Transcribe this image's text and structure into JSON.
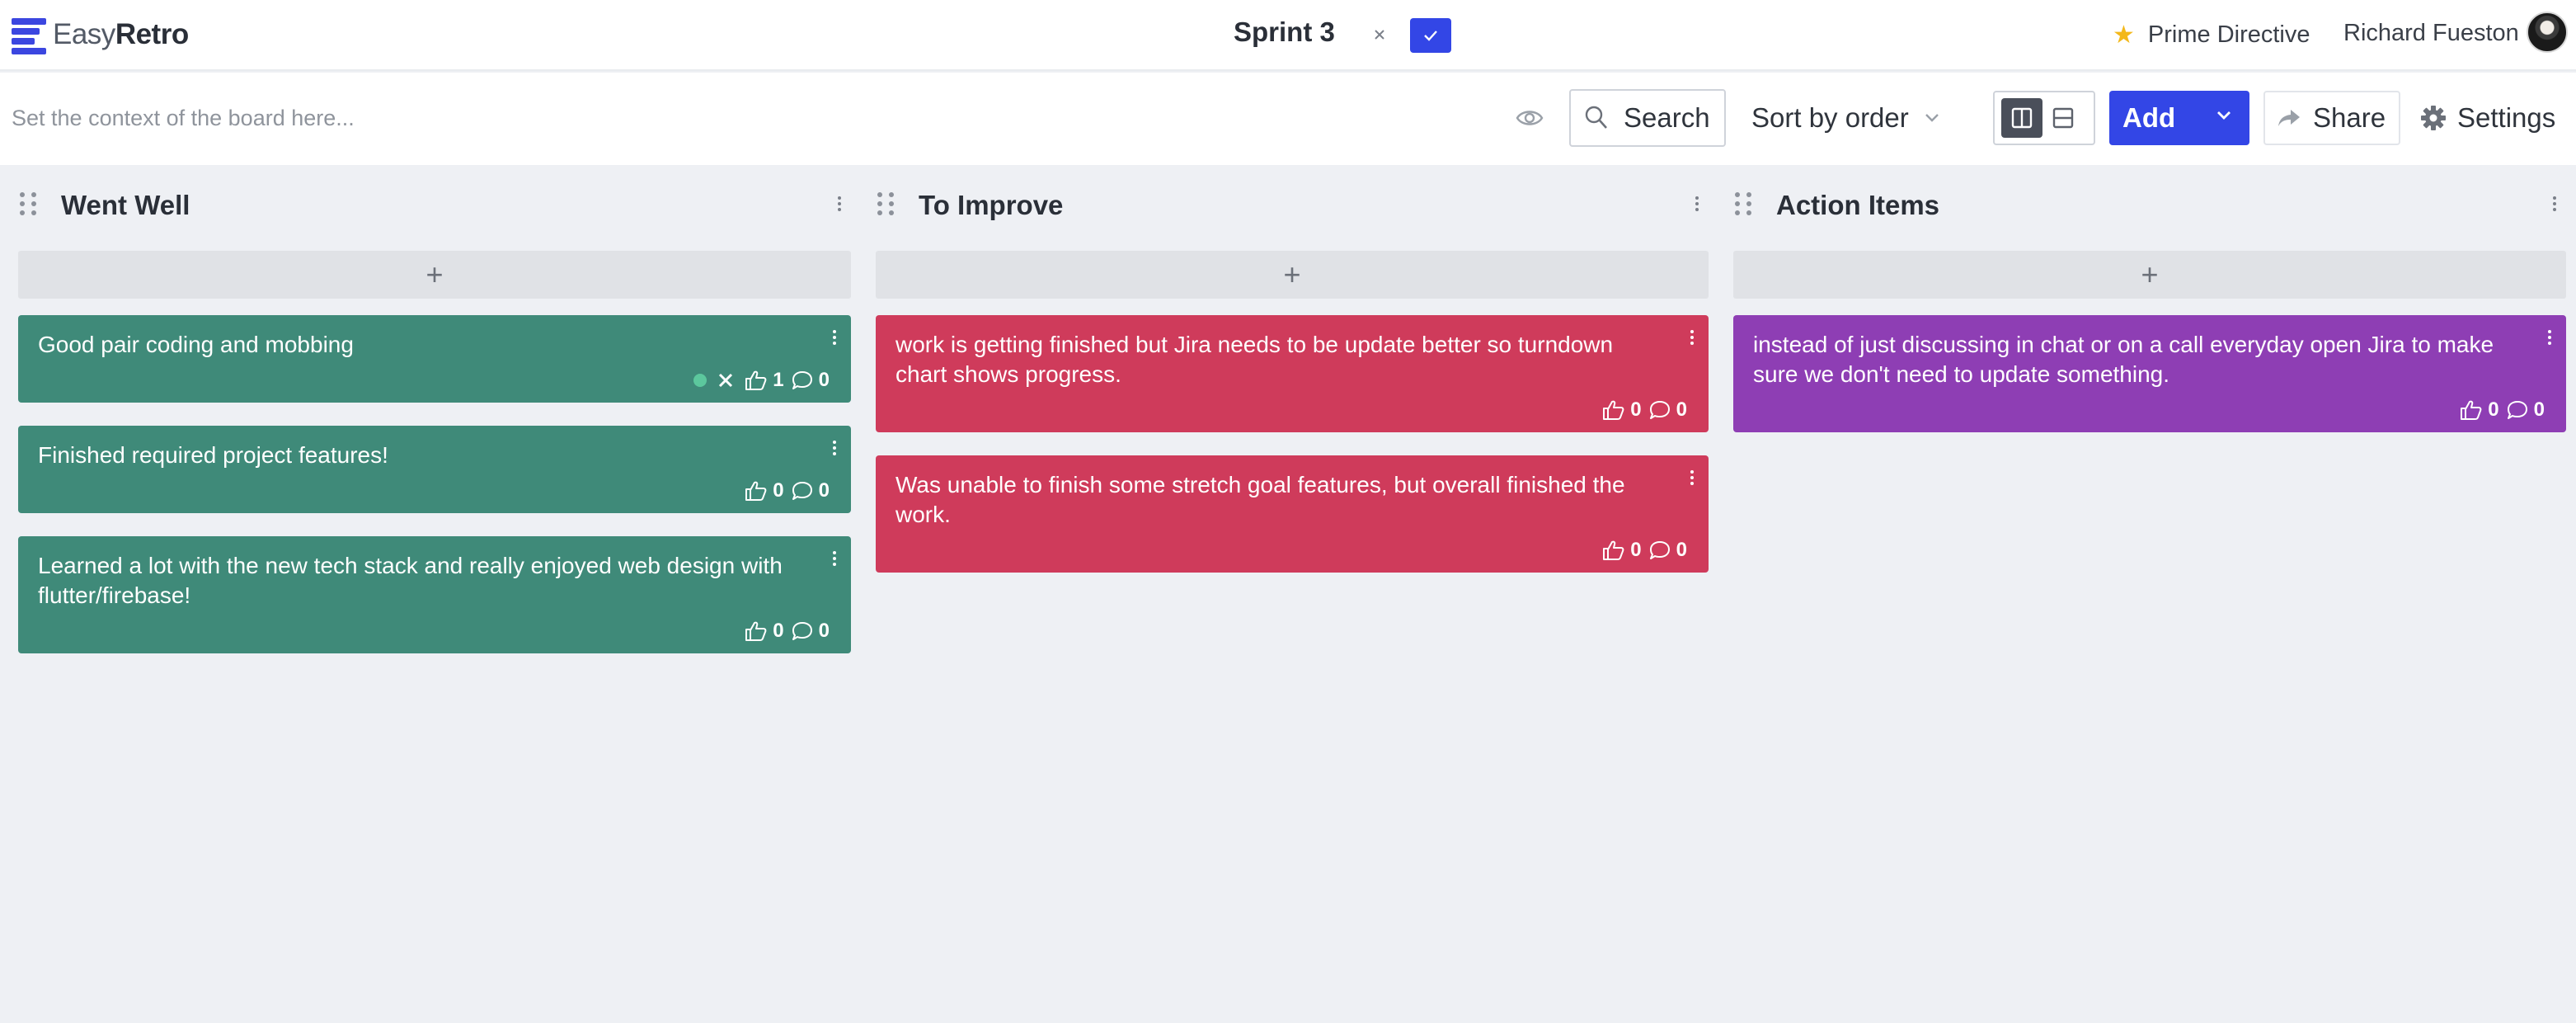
{
  "app": {
    "logo_light": "Easy",
    "logo_bold": "Retro"
  },
  "header": {
    "board_title": "Sprint 3",
    "cancel_icon": "close-icon",
    "confirm_icon": "check-icon",
    "prime_directive": "Prime Directive",
    "user_name": "Richard Fueston",
    "accent": "#3346e6"
  },
  "toolbar": {
    "context_placeholder": "Set the context of the board here...",
    "search_label": "Search",
    "sort_label": "Sort by order",
    "add_label": "Add",
    "share_label": "Share",
    "settings_label": "Settings",
    "view_mode": "columns"
  },
  "columns": [
    {
      "title": "Went Well",
      "color": "#3f8a79",
      "add_symbol": "+",
      "cards": [
        {
          "text": "Good pair coding and mobbing",
          "votes": "1",
          "comments": "0",
          "selected": true
        },
        {
          "text": "Finished required project features!",
          "votes": "0",
          "comments": "0"
        },
        {
          "text": "Learned a lot with the new tech stack and really enjoyed web design with flutter/firebase!",
          "votes": "0",
          "comments": "0"
        }
      ]
    },
    {
      "title": "To Improve",
      "color": "#cf3b5b",
      "add_symbol": "+",
      "cards": [
        {
          "text": "work is getting finished but Jira needs to be update better so turndown chart shows progress.",
          "votes": "0",
          "comments": "0"
        },
        {
          "text": "Was unable to finish some stretch goal features, but overall finished the work.",
          "votes": "0",
          "comments": "0"
        }
      ]
    },
    {
      "title": "Action Items",
      "color": "#8e3eb4",
      "add_symbol": "+",
      "cards": [
        {
          "text": "instead of just discussing in chat or on a call everyday open Jira to make sure we don't need to update something.",
          "votes": "0",
          "comments": "0"
        }
      ]
    }
  ]
}
